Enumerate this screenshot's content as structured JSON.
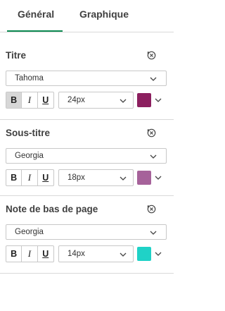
{
  "tabs": [
    {
      "label": "Général",
      "active": true
    },
    {
      "label": "Graphique",
      "active": false
    }
  ],
  "sections": [
    {
      "title": "Titre",
      "font": "Tahoma",
      "bold_active": true,
      "size": "24px",
      "color": "#8c1f5f"
    },
    {
      "title": "Sous-titre",
      "font": "Georgia",
      "bold_active": false,
      "size": "18px",
      "color": "#a6629a"
    },
    {
      "title": "Note de bas de page",
      "font": "Georgia",
      "bold_active": false,
      "size": "14px",
      "color": "#1fd2c7"
    }
  ],
  "format": {
    "bold": "B",
    "italic": "I",
    "underline": "U"
  },
  "icons": {
    "reset": "reset-circle-x-icon",
    "dropdown": "chevron-down-icon"
  },
  "colors": {
    "accent": "#0d8a52",
    "border": "#c8c8c8",
    "divider": "#d9d9d9"
  }
}
